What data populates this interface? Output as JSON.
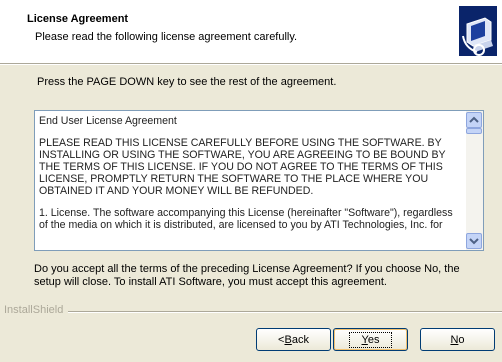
{
  "header": {
    "title": "License Agreement",
    "subtitle": "Please read the following license agreement carefully.",
    "icon": "computer-setup-icon"
  },
  "instruction": "Press the PAGE DOWN key to see the rest of the agreement.",
  "license": {
    "heading": "End User License Agreement",
    "paragraph1": "PLEASE READ THIS LICENSE CAREFULLY BEFORE USING THE SOFTWARE. BY INSTALLING OR USING THE SOFTWARE, YOU ARE AGREEING TO BE BOUND BY THE TERMS OF THIS LICENSE.  IF YOU DO NOT AGREE TO THE TERMS OF THIS LICENSE, PROMPTLY RETURN THE SOFTWARE TO THE PLACE WHERE YOU OBTAINED IT AND YOUR MONEY WILL BE REFUNDED.",
    "paragraph2": "1. License.  The software accompanying this License (hereinafter \"Software\"), regardless of the media on which it is distributed, are licensed to you by ATI Technologies, Inc. for"
  },
  "accept_question": "Do you accept all the terms of the preceding License Agreement?  If you choose No,  the setup will close.  To install ATI Software, you must accept this agreement.",
  "footer": {
    "brand": "InstallShield"
  },
  "buttons": {
    "back": {
      "pre": "< ",
      "key": "B",
      "rest": "ack"
    },
    "yes": {
      "key": "Y",
      "rest": "es"
    },
    "no": {
      "key": "N",
      "rest": "o"
    }
  }
}
